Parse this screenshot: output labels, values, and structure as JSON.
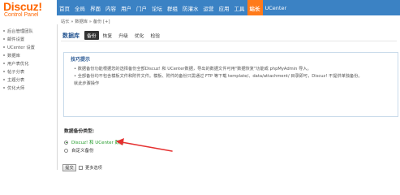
{
  "logo": {
    "title": "Discuz!",
    "subtitle": "Control Panel"
  },
  "topnav": {
    "items": [
      "首页",
      "全局",
      "界面",
      "内容",
      "用户",
      "门户",
      "论坛",
      "群组",
      "防灌水",
      "运营",
      "应用",
      "工具",
      "站长",
      "UCenter"
    ],
    "active_index": 12,
    "bg_color": "#3b82c4",
    "active_color": "#ff7a1a"
  },
  "sidebar": {
    "items": [
      "后台管理团队",
      "邮件设置",
      "UCenter 设置",
      "数据库",
      "用户表优化",
      "帖子分表",
      "主题分表",
      "优化大师"
    ]
  },
  "breadcrumb": "站长 » 数据库 » 备份 [+]",
  "section": {
    "title": "数据库",
    "tabs": [
      "备份",
      "恢复",
      "升级",
      "优化",
      "检验"
    ],
    "active_tab": 0
  },
  "tips": {
    "title": "技巧提示",
    "lines": [
      "• 数据备份功能根据您的选择备份全部Discuz! 和 UCenter数据，导出的数据文件可用\"数据恢复\"功能或 phpMyAdmin 导入。",
      "• 全部备份均不包含模板文件和附件文件。模板、附件的备份只需通过 FTP 等下载 template/、data/attachment/ 目录即可，Discuz! 不提供单独备份。",
      "  就此步骤操作"
    ]
  },
  "backup_type": {
    "label": "数据备份类型:",
    "options": [
      {
        "text": "Discuz! 和 UCenter 数据",
        "selected": true
      },
      {
        "text": "自定义备份",
        "selected": false
      }
    ]
  },
  "form": {
    "submit_label": "提交",
    "more_options_label": "更多选项"
  },
  "colors": {
    "logo": "#ff6600",
    "accent_blue": "#2b5a94",
    "selected_option": "#1f9a27",
    "arrow": "#e53030"
  }
}
